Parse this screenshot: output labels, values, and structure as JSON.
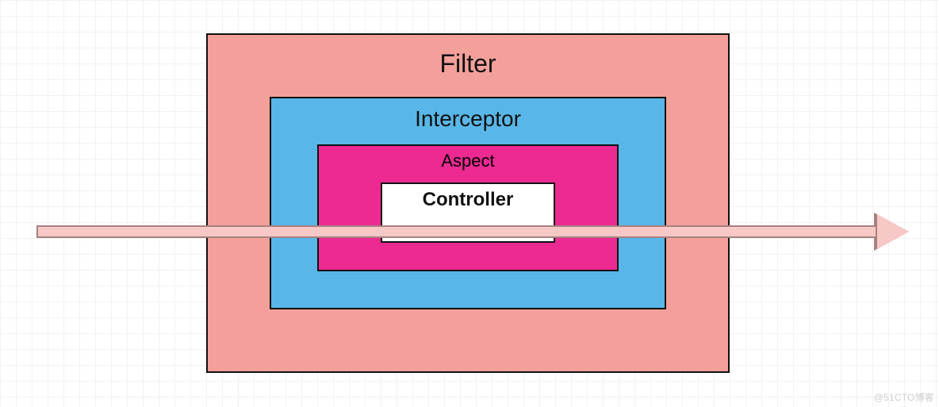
{
  "layers": {
    "filter": {
      "label": "Filter"
    },
    "interceptor": {
      "label": "Interceptor"
    },
    "aspect": {
      "label": "Aspect"
    },
    "controller": {
      "label": "Controller"
    }
  },
  "watermark": "@51CTO博客",
  "colors": {
    "filter": "#f4a09a",
    "interceptor": "#58b7e8",
    "aspect": "#ed2a92",
    "controller": "#ffffff",
    "arrow_fill": "#f7c8c6",
    "arrow_border": "#a78180",
    "grid": "#f1f2f3"
  }
}
